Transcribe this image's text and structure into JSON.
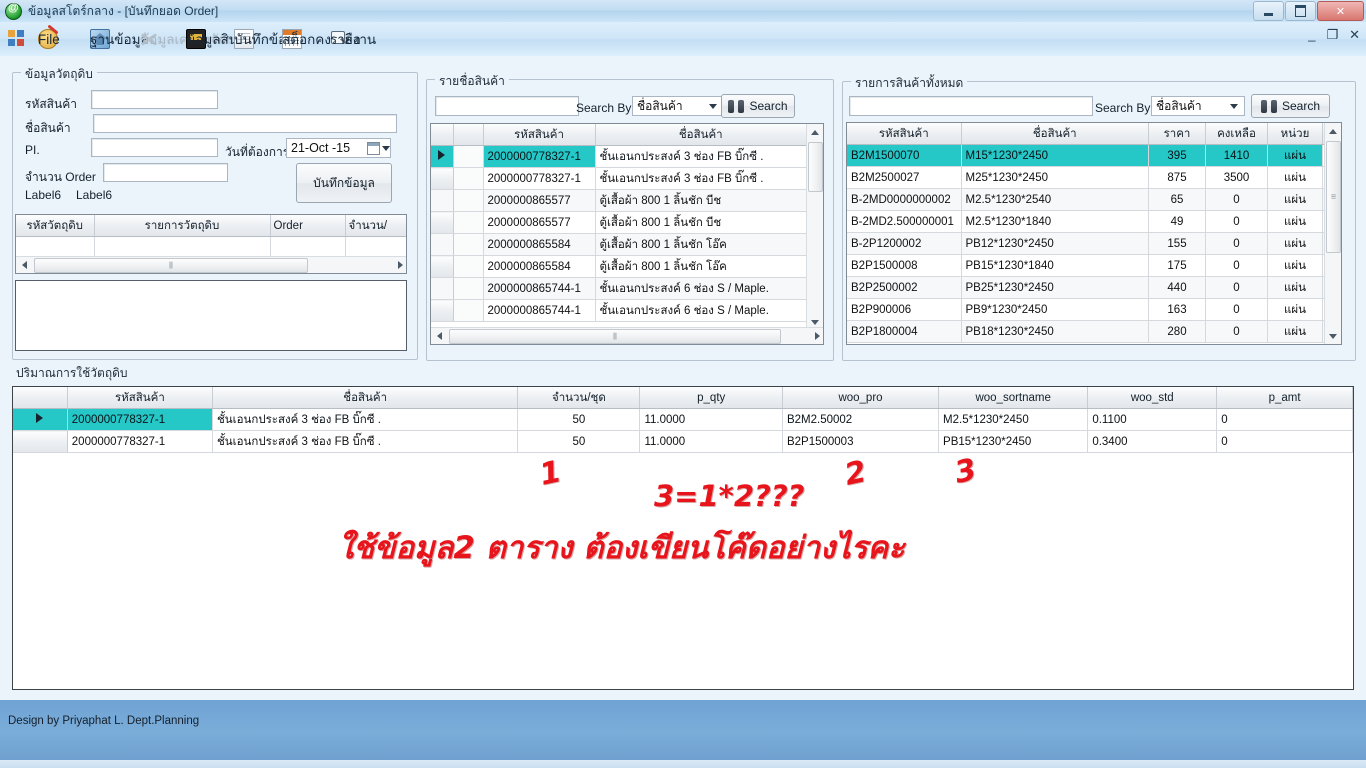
{
  "window": {
    "title": "ข้อมูลสโตร์กลาง - [บันทึกยอด Order]",
    "ghost_title": "",
    "minimize": "—",
    "restore": "❐",
    "close": "✕"
  },
  "mdi": {
    "minimize": "_",
    "restore": "❐",
    "close": "✕"
  },
  "menu": {
    "items": [
      {
        "label": "File",
        "icon": "magnifier-face-icon",
        "disabled": false
      },
      {
        "label": "ฐานข้อมูล",
        "icon": "database-book-icon",
        "disabled": false
      },
      {
        "label": "ข้อมูลเครื่องจักร",
        "icon": "tools-icon",
        "disabled": true
      },
      {
        "label": "ข้อมูลสินค้า",
        "icon": "dark-book-icon",
        "disabled": false
      },
      {
        "label": "บันทึกข้อมูล",
        "icon": "pages-icon",
        "disabled": false
      },
      {
        "label": "สต็อกคงเหลือ",
        "icon": "calendar-icon",
        "disabled": false
      },
      {
        "label": "รายงาน",
        "icon": "magnifier-icon",
        "disabled": false
      }
    ]
  },
  "material_group": {
    "title": "ข้อมูลวัตถุดิบ",
    "fields": [
      {
        "label": "รหัสสินค้า",
        "value": "",
        "placeholder": ""
      },
      {
        "label": "ชื่อสินค้า",
        "value": "",
        "placeholder": ""
      },
      {
        "label": "PI.",
        "value": "",
        "placeholder": ""
      },
      {
        "label": "จำนวน Order",
        "value": "",
        "placeholder": ""
      }
    ],
    "date_label": "วันที่ต้องการ",
    "date_value": "21-Oct -15",
    "save_button": "บันทึกข้อมูล",
    "label6_a": "Label6",
    "label6_b": "Label6",
    "grid": {
      "columns": [
        "รหัสวัตถุดิบ",
        "รายการวัตถุดิบ",
        "Order",
        "จำนวน/"
      ],
      "rows": []
    }
  },
  "product_list_group": {
    "title": "รายชื่อสินค้า",
    "search_value": "",
    "search_by_label": "Search By",
    "search_by_value": "ชื่อสินค้า",
    "search_button": "Search",
    "columns": [
      "รหัสสินค้า",
      "ชื่อสินค้า"
    ],
    "rows": [
      {
        "code": "2000000778327-1",
        "name": "ชั้นเอนกประสงค์ 3 ช่อง FB บิ๊กซี .",
        "selected": true
      },
      {
        "code": "2000000778327-1",
        "name": "ชั้นเอนกประสงค์ 3 ช่อง FB บิ๊กซี .",
        "selected": false
      },
      {
        "code": "2000000865577",
        "name": "ตู้เสื้อผ้า 800 1 ลิ้นชัก บีช",
        "selected": false
      },
      {
        "code": "2000000865577",
        "name": "ตู้เสื้อผ้า 800 1 ลิ้นชัก บีช",
        "selected": false
      },
      {
        "code": "2000000865584",
        "name": "ตู้เสื้อผ้า 800 1 ลิ้นชัก โอ๊ค",
        "selected": false
      },
      {
        "code": "2000000865584",
        "name": "ตู้เสื้อผ้า 800 1 ลิ้นชัก โอ๊ค",
        "selected": false
      },
      {
        "code": "2000000865744-1",
        "name": "ชั้นเอนกประสงค์ 6 ช่อง S / Maple.",
        "selected": false
      },
      {
        "code": "2000000865744-1",
        "name": "ชั้นเอนกประสงค์ 6 ช่อง S / Maple.",
        "selected": false
      }
    ]
  },
  "all_products_group": {
    "title": "รายการสินค้าทั้งหมด",
    "search_value": "",
    "search_by_label": "Search By",
    "search_by_value": "ชื่อสินค้า",
    "search_button": "Search",
    "columns": [
      "รหัสสินค้า",
      "ชื่อสินค้า",
      "ราคา",
      "คงเหลือ",
      "หน่วย"
    ],
    "rows": [
      {
        "code": "B2M1500070",
        "name": "M15*1230*2450",
        "price": "395",
        "remain": "1410",
        "unit": "แผ่น",
        "selected": true
      },
      {
        "code": "B2M2500027",
        "name": "M25*1230*2450",
        "price": "875",
        "remain": "3500",
        "unit": "แผ่น",
        "selected": false
      },
      {
        "code": "B-2MD0000000002",
        "name": "M2.5*1230*2540",
        "price": "65",
        "remain": "0",
        "unit": "แผ่น",
        "selected": false
      },
      {
        "code": "B-2MD2.500000001",
        "name": "M2.5*1230*1840",
        "price": "49",
        "remain": "0",
        "unit": "แผ่น",
        "selected": false
      },
      {
        "code": "B-2P1200002",
        "name": "PB12*1230*2450",
        "price": "155",
        "remain": "0",
        "unit": "แผ่น",
        "selected": false
      },
      {
        "code": "B2P1500008",
        "name": "PB15*1230*1840",
        "price": "175",
        "remain": "0",
        "unit": "แผ่น",
        "selected": false
      },
      {
        "code": "B2P2500002",
        "name": "PB25*1230*2450",
        "price": "440",
        "remain": "0",
        "unit": "แผ่น",
        "selected": false
      },
      {
        "code": "B2P900006",
        "name": "PB9*1230*2450",
        "price": "163",
        "remain": "0",
        "unit": "แผ่น",
        "selected": false
      },
      {
        "code": "B2P1800004",
        "name": "PB18*1230*2450",
        "price": "280",
        "remain": "0",
        "unit": "แผ่น",
        "selected": false
      }
    ]
  },
  "usage_group": {
    "title": "ปริมาณการใช้วัตถุดิบ",
    "columns": [
      "รหัสสินค้า",
      "ชื่อสินค้า",
      "จำนวน/ชุด",
      "p_qty",
      "woo_pro",
      "woo_sortname",
      "woo_std",
      "p_amt"
    ],
    "rows": [
      {
        "code": "2000000778327-1",
        "name": "ชั้นเอนกประสงค์ 3 ช่อง FB บิ๊กซี .",
        "qty_set": "50",
        "p_qty": "11.0000",
        "woo_pro": "B2M2.50002",
        "woo_sortname": "M2.5*1230*2450",
        "woo_std": "0.1100",
        "p_amt": "0",
        "selected": true
      },
      {
        "code": "2000000778327-1",
        "name": "ชั้นเอนกประสงค์ 3 ช่อง FB บิ๊กซี .",
        "qty_set": "50",
        "p_qty": "11.0000",
        "woo_pro": "B2P1500003",
        "woo_sortname": "PB15*1230*2450",
        "woo_std": "0.3400",
        "p_amt": "0",
        "selected": false
      }
    ]
  },
  "annotations": {
    "marker_1": "1",
    "marker_2": "2",
    "marker_3": "3",
    "formula": "3=1*2???",
    "question": "ใช้ข้อมูล2 ตาราง ต้องเขียนโค๊ดอย่างไรคะ",
    "color": "#e8141b"
  },
  "status": {
    "credit": "Design by Priyaphat L. Dept.Planning"
  },
  "colors": {
    "selection_teal": "#25c7c7",
    "title_blue": "#b4d4ee",
    "footer_blue": "#7badd9"
  }
}
